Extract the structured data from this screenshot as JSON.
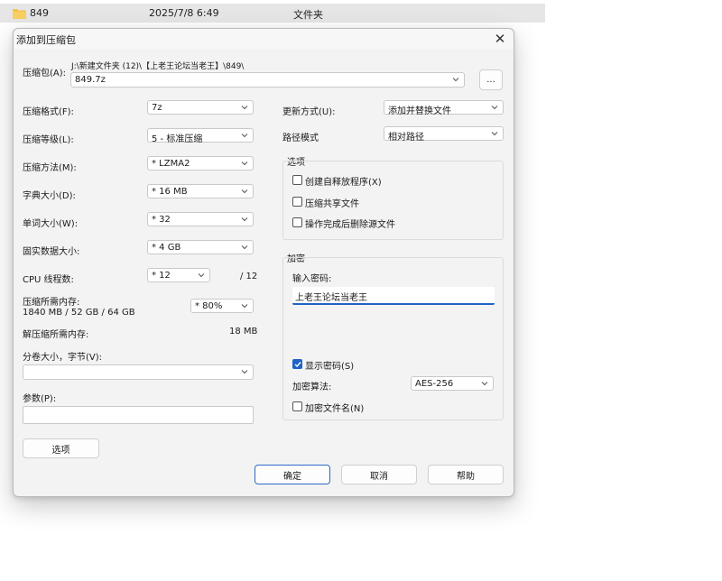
{
  "explorer_row": {
    "name": "849",
    "date": "2025/7/8 6:49",
    "type": "文件夹"
  },
  "dialog": {
    "title": "添加到压缩包",
    "close_glyph": "✕",
    "archive_label": "压缩包(A):",
    "archive_path": "J:\\新建文件夹 (12)\\【上老王论坛当老王】\\849\\",
    "archive_name": "849.7z",
    "browse_label": "...",
    "format_label": "压缩格式(F):",
    "format_value": "7z",
    "level_label": "压缩等级(L):",
    "level_value": "5 - 标准压缩",
    "method_label": "压缩方法(M):",
    "method_value": "* LZMA2",
    "dict_label": "字典大小(D):",
    "dict_value": "* 16 MB",
    "word_label": "单词大小(W):",
    "word_value": "* 32",
    "solid_label": "固实数据大小:",
    "solid_value": "* 4 GB",
    "cpu_label": "CPU 线程数:",
    "cpu_value": "* 12",
    "cpu_total": "/ 12",
    "mem_label": "压缩所需内存:",
    "mem_detail": "1840 MB / 52 GB / 64 GB",
    "mem_value": "* 80%",
    "decomp_label": "解压缩所需内存:",
    "decomp_value": "18 MB",
    "split_label": "分卷大小，字节(V):",
    "split_value": "",
    "params_label": "参数(P):",
    "params_value": "",
    "options_button": "选项",
    "update_label": "更新方式(U):",
    "update_value": "添加并替换文件",
    "path_label": "路径模式",
    "path_value": "相对路径",
    "options_group": {
      "title": "选项",
      "sfx": "创建自释放程序(X)",
      "shared": "压缩共享文件",
      "delete": "操作完成后删除源文件"
    },
    "encrypt_group": {
      "title": "加密",
      "password_label": "输入密码:",
      "password_value": "上老王论坛当老王",
      "show_password": "显示密码(S)",
      "method_label": "加密算法:",
      "method_value": "AES-256",
      "encrypt_names": "加密文件名(N)"
    },
    "ok_button": "确定",
    "cancel_button": "取消",
    "help_button": "帮助"
  },
  "colors": {
    "accent": "#1f63c6",
    "dialog_bg": "#f3f3f3"
  },
  "icons": [
    "folder-icon",
    "close-icon",
    "chevron-down-icon",
    "checkmark-icon"
  ]
}
